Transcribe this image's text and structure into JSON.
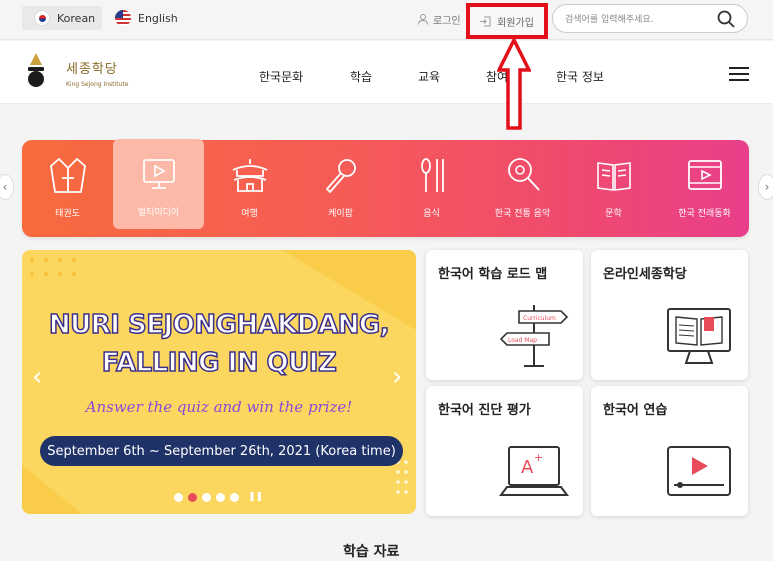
{
  "topbar": {
    "lang_korean": "Korean",
    "lang_english": "English",
    "login": "로그인",
    "signup": "회원가입",
    "search_placeholder": "검색어를 입력해주세요."
  },
  "logo": {
    "ko": "세종학당",
    "en": "King Sejong Institute"
  },
  "nav": [
    "한국문화",
    "학습",
    "교육",
    "참여",
    "한국 정보"
  ],
  "categories": [
    "태권도",
    "멀티미디어",
    "여행",
    "케이팝",
    "음식",
    "한국 전통 음악",
    "문학",
    "한국 전래동화"
  ],
  "banner": {
    "title1": "NURI SEJONGHAKDANG,",
    "title2": "FALLING IN QUIZ",
    "subtitle": "Answer the quiz and win the prize!",
    "date": "September 6th ~ September 26th, 2021 (Korea time)"
  },
  "cards": [
    "한국어 학습 로드 맵",
    "온라인세종학당",
    "한국어 진단 평가",
    "한국어 연습"
  ],
  "roadmap_signs": [
    "Curriculum",
    "Load Map"
  ],
  "bottom_heading": "학습 자료",
  "colors": {
    "highlight_box": "#e3101a",
    "category_start": "#f76b3d",
    "category_end": "#e83f8a",
    "banner_bg": "#fcd75f",
    "date_pill": "#1f3369"
  }
}
